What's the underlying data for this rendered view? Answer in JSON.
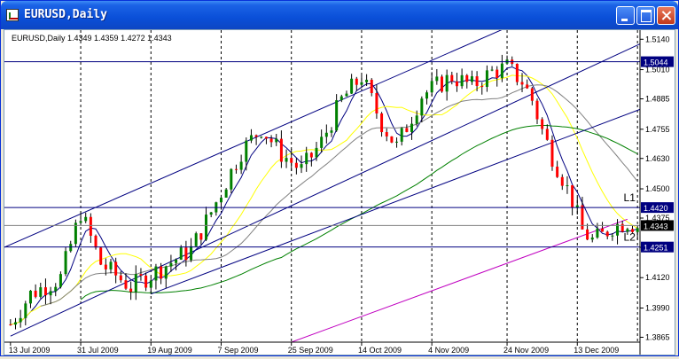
{
  "window": {
    "title": "EURUSD,Daily",
    "icon": "chart-window-icon",
    "buttons": [
      "minimize-icon",
      "maximize-icon",
      "close-icon"
    ]
  },
  "chart_data": {
    "type": "candlestick",
    "info_label": "EURUSD,Daily  1.4349 1.4359 1.4272 1.4343",
    "ylim": [
      1.3844,
      1.5179
    ],
    "y_ticks": [
      "1.5140",
      "1.5010",
      "1.4885",
      "1.4755",
      "1.4630",
      "1.4500",
      "1.4375",
      "1.4250",
      "1.4120",
      "1.3990",
      "1.3865"
    ],
    "x_ticks": [
      "13 Jul 2009",
      "31 Jul 2009",
      "19 Aug 2009",
      "7 Sep 2009",
      "25 Sep 2009",
      "14 Oct 2009",
      "4 Nov 2009",
      "24 Nov 2009",
      "13 Dec 2009"
    ],
    "bars": 126,
    "levels": [
      {
        "label": "1.5044",
        "value": 1.5044,
        "color": "#000080",
        "name": ""
      },
      {
        "label": "1.4420",
        "value": 1.442,
        "color": "#000080",
        "name": "L1"
      },
      {
        "label": "1.4251",
        "value": 1.4251,
        "color": "#000080",
        "name": "L2"
      }
    ],
    "current_price": "1.4343",
    "colors": {
      "bull": "#008000",
      "bear": "#ff0000",
      "wick": "#000000",
      "ma_fast": "#000080",
      "ma_mid": "#ffff00",
      "ma_slow": "#808080",
      "ma_green": "#008000",
      "ma_long": "#c000c0",
      "channel": "#000080"
    }
  }
}
